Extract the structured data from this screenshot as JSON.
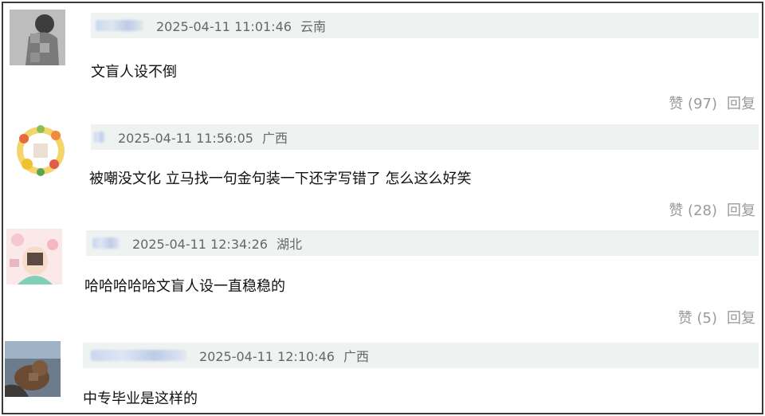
{
  "comments": [
    {
      "timestamp": "2025-04-11 11:01:46",
      "location": "云南",
      "text": "文盲人设不倒",
      "like_label": "赞 (97)",
      "reply_label": "回复"
    },
    {
      "timestamp": "2025-04-11 11:56:05",
      "location": "广西",
      "text": "被嘲没文化 立马找一句金句装一下还字写错了 怎么这么好笑",
      "like_label": "赞 (28)",
      "reply_label": "回复"
    },
    {
      "timestamp": "2025-04-11 12:34:26",
      "location": "湖北",
      "text": "哈哈哈哈哈文盲人设一直稳稳的",
      "like_label": "赞 (5)",
      "reply_label": "回复"
    },
    {
      "timestamp": "2025-04-11 12:10:46",
      "location": "广西",
      "text": "中专毕业是这样的",
      "like_label": "",
      "reply_label": ""
    }
  ],
  "icons": {
    "avatar_1": "blurred-grey-photo-avatar-icon",
    "avatar_2": "flower-wreath-avatar-icon",
    "avatar_3": "pink-cartoon-avatar-icon",
    "avatar_4": "cat-photo-avatar-icon"
  }
}
